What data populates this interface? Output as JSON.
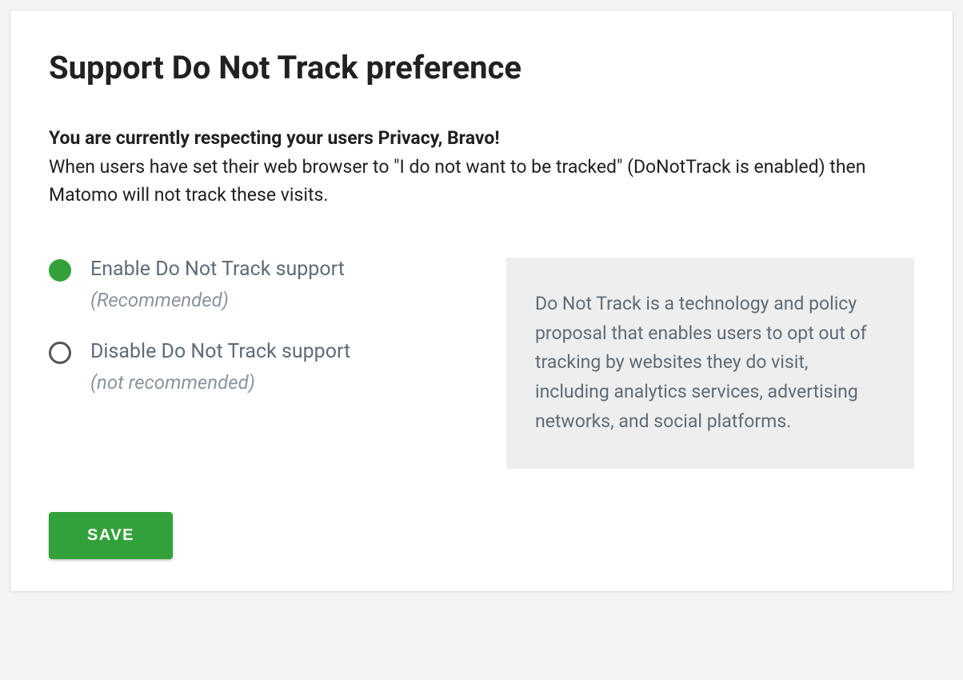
{
  "title": "Support Do Not Track preference",
  "intro": {
    "bold": "You are currently respecting your users Privacy, Bravo!",
    "text": "When users have set their web browser to \"I do not want to be tracked\" (DoNotTrack is enabled) then Matomo will not track these visits."
  },
  "options": [
    {
      "label": "Enable Do Not Track support",
      "hint": "(Recommended)",
      "selected": true
    },
    {
      "label": "Disable Do Not Track support",
      "hint": "(not recommended)",
      "selected": false
    }
  ],
  "info": "Do Not Track is a technology and policy proposal that enables users to opt out of tracking by websites they do visit, including analytics services, advertising networks, and social platforms.",
  "buttons": {
    "save": "SAVE"
  },
  "colors": {
    "accent": "#32a13a"
  }
}
